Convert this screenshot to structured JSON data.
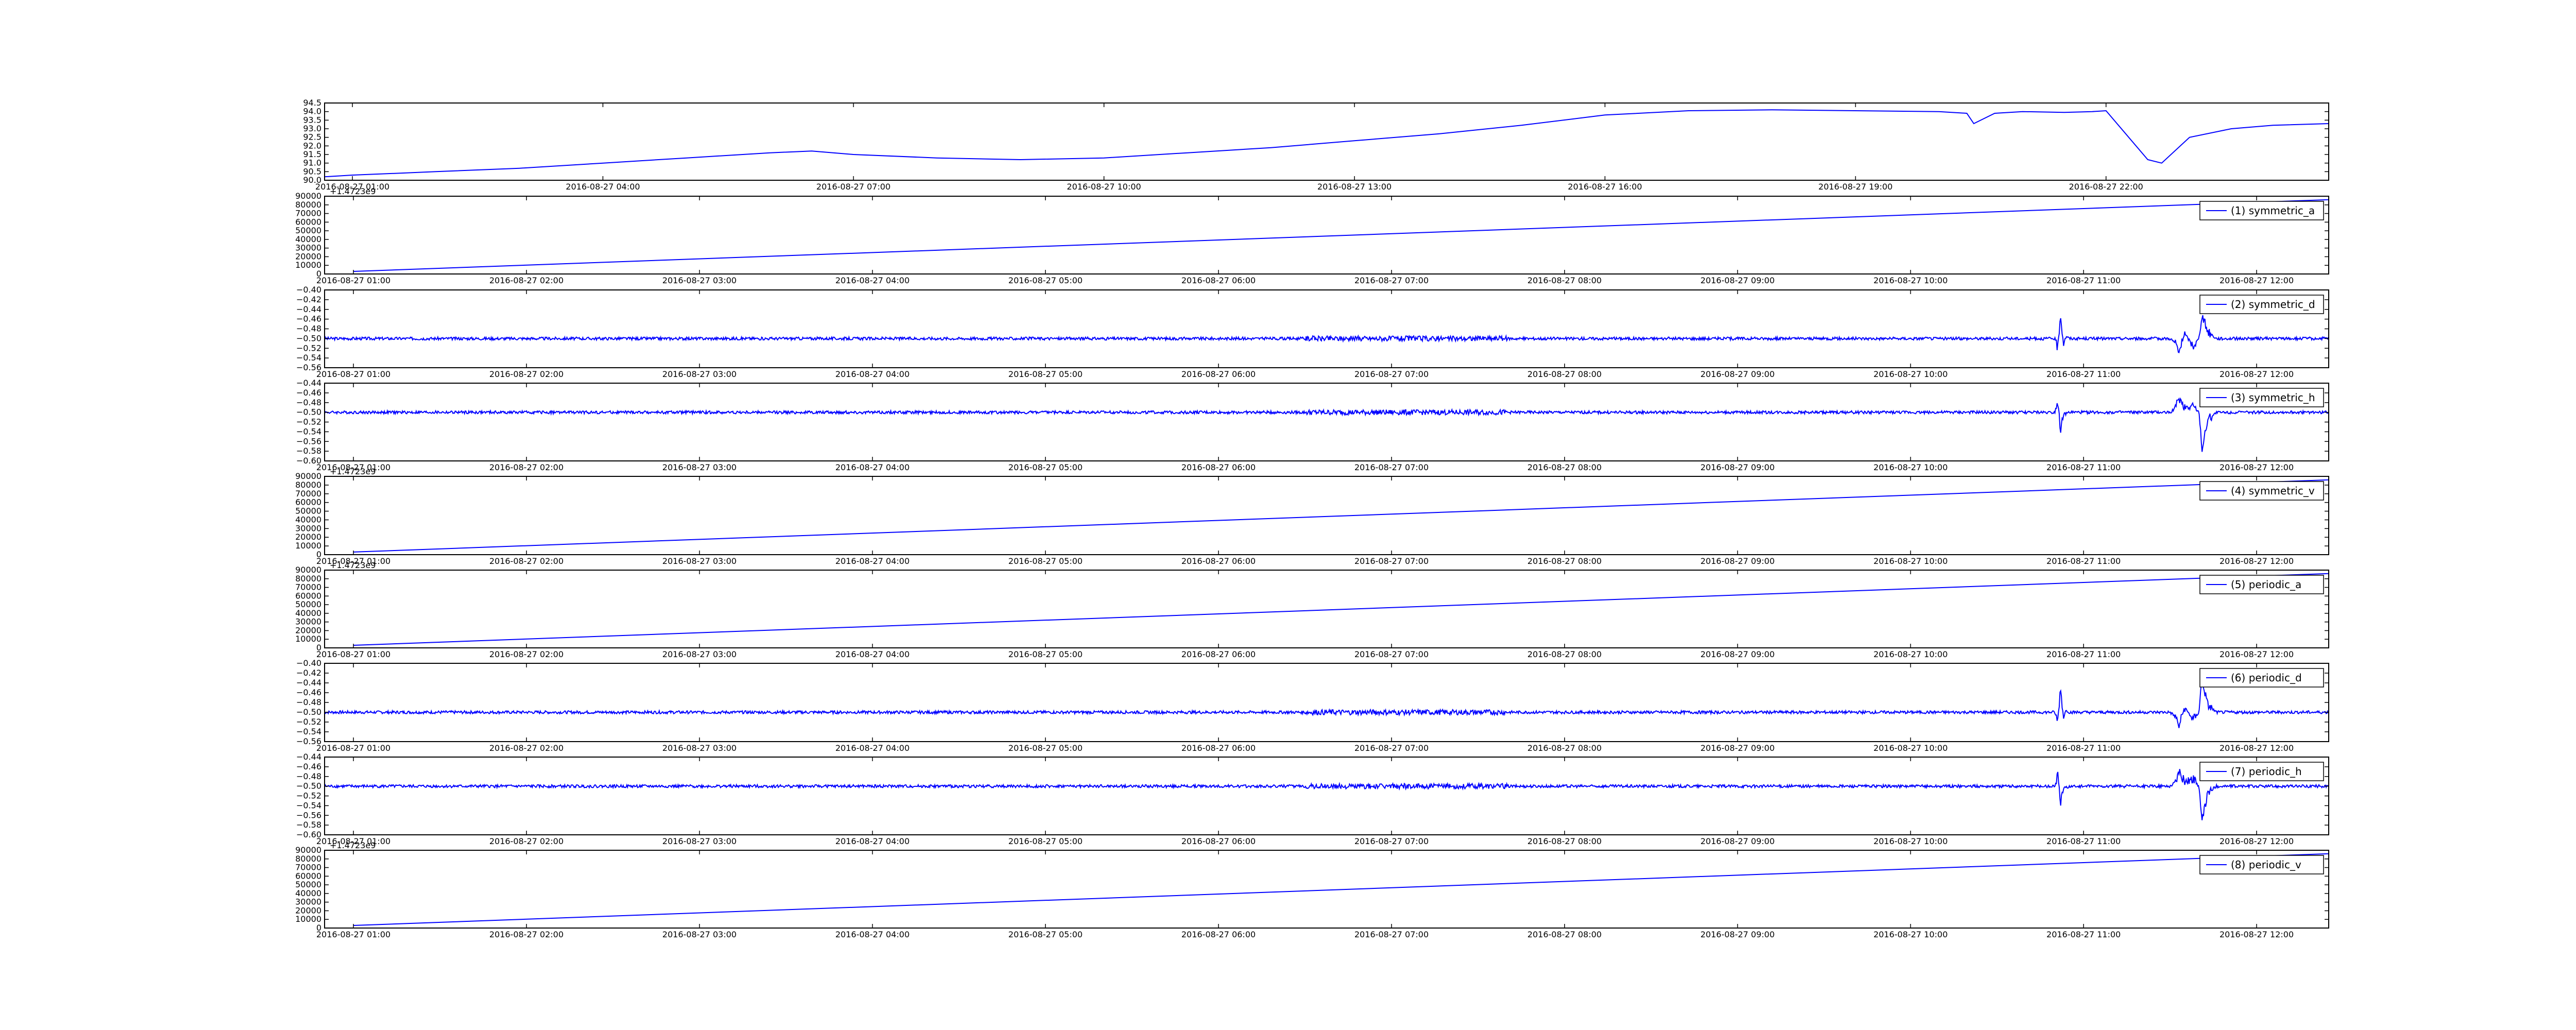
{
  "figure": {
    "line_color": "#0000ff",
    "axis_color": "#000000",
    "background": "#ffffff"
  },
  "chart_data": [
    {
      "type": "line",
      "title": "",
      "xlabel": "",
      "ylabel": "",
      "offset_label": "",
      "legend": null,
      "ylim": [
        90.0,
        94.5
      ],
      "y_ticks": [
        "90.0",
        "90.5",
        "91.0",
        "91.5",
        "92.0",
        "92.5",
        "93.0",
        "93.5",
        "94.0",
        "94.5"
      ],
      "x_ticks": [
        "2016-08-27 01:00",
        "2016-08-27 04:00",
        "2016-08-27 07:00",
        "2016-08-27 10:00",
        "2016-08-27 13:00",
        "2016-08-27 16:00",
        "2016-08-27 19:00",
        "2016-08-27 22:00"
      ],
      "x_tick_labels": [
        "2016-08-27 01:00",
        "2016-08-27 04:00",
        "2016-08-27 07:00",
        "2016-08-27 10:00",
        "2016-08-27 13:00",
        "2016-08-27 16:00",
        "2016-08-27 19:00",
        "2016-08-27 22:00"
      ],
      "xlim": [
        "2016-08-27 00:40",
        "2016-08-28 00:40"
      ],
      "series": [
        {
          "x": [
            "2016-08-27 00:40",
            "2016-08-27 01:00",
            "2016-08-27 01:30",
            "2016-08-27 02:00",
            "2016-08-27 03:00",
            "2016-08-27 04:00",
            "2016-08-27 05:00",
            "2016-08-27 06:00",
            "2016-08-27 06:30",
            "2016-08-27 07:00",
            "2016-08-27 08:00",
            "2016-08-27 09:00",
            "2016-08-27 10:00",
            "2016-08-27 11:00",
            "2016-08-27 12:00",
            "2016-08-27 13:00",
            "2016-08-27 14:00",
            "2016-08-27 15:00",
            "2016-08-27 16:00",
            "2016-08-27 17:00",
            "2016-08-27 18:00",
            "2016-08-27 19:00",
            "2016-08-27 20:00",
            "2016-08-27 20:20",
            "2016-08-27 20:25",
            "2016-08-27 20:40",
            "2016-08-27 21:00",
            "2016-08-27 21:30",
            "2016-08-27 21:50",
            "2016-08-27 22:00",
            "2016-08-27 22:30",
            "2016-08-27 22:40",
            "2016-08-27 23:00",
            "2016-08-27 23:30",
            "2016-08-28 00:00",
            "2016-08-28 00:40"
          ],
          "y": [
            90.2,
            90.3,
            90.4,
            90.5,
            90.7,
            91.0,
            91.3,
            91.6,
            91.7,
            91.5,
            91.3,
            91.2,
            91.3,
            91.6,
            91.9,
            92.3,
            92.7,
            93.2,
            93.8,
            94.05,
            94.1,
            94.05,
            94.0,
            93.9,
            93.3,
            93.9,
            94.0,
            93.95,
            94.0,
            94.05,
            91.2,
            91.0,
            92.5,
            93.0,
            93.2,
            93.3
          ]
        }
      ]
    },
    {
      "type": "line",
      "title": "",
      "xlabel": "",
      "ylabel": "",
      "offset_label": "+1.4723e9",
      "legend": "(1) symmetric_a",
      "ylim": [
        0,
        90000
      ],
      "y_ticks": [
        "0",
        "10000",
        "20000",
        "30000",
        "40000",
        "50000",
        "60000",
        "70000",
        "80000",
        "90000"
      ],
      "x_ticks": [
        "2016-08-27 01:00",
        "2016-08-27 02:00",
        "2016-08-27 03:00",
        "2016-08-27 04:00",
        "2016-08-27 05:00",
        "2016-08-27 06:00",
        "2016-08-27 07:00",
        "2016-08-27 08:00",
        "2016-08-27 09:00",
        "2016-08-27 10:00",
        "2016-08-27 11:00",
        "2016-08-27 12:00"
      ],
      "x_tick_labels": [
        "2016-08-27 01:00",
        "2016-08-27 02:00",
        "2016-08-27 03:00",
        "2016-08-27 04:00",
        "2016-08-27 05:00",
        "2016-08-27 06:00",
        "2016-08-27 07:00",
        "2016-08-27 08:00",
        "2016-08-27 09:00",
        "2016-08-27 10:00",
        "2016-08-27 11:00",
        "2016-08-27 12:00"
      ],
      "xlim": [
        "2016-08-27 00:50",
        "2016-08-27 12:25"
      ],
      "series": [
        {
          "name": "(1) symmetric_a",
          "x": [
            "2016-08-27 01:00",
            "2016-08-27 12:25"
          ],
          "y": [
            3000,
            86000
          ]
        }
      ]
    },
    {
      "type": "line",
      "title": "",
      "xlabel": "",
      "ylabel": "",
      "offset_label": "",
      "legend": "(2) symmetric_d",
      "ylim": [
        -0.56,
        -0.4
      ],
      "y_ticks": [
        "-0.56",
        "-0.54",
        "-0.52",
        "-0.50",
        "-0.48",
        "-0.46",
        "-0.44",
        "-0.42",
        "-0.40"
      ],
      "x_ticks": [
        "2016-08-27 01:00",
        "2016-08-27 02:00",
        "2016-08-27 03:00",
        "2016-08-27 04:00",
        "2016-08-27 05:00",
        "2016-08-27 06:00",
        "2016-08-27 07:00",
        "2016-08-27 08:00",
        "2016-08-27 09:00",
        "2016-08-27 10:00",
        "2016-08-27 11:00",
        "2016-08-27 12:00"
      ],
      "x_tick_labels": [
        "2016-08-27 01:00",
        "2016-08-27 02:00",
        "2016-08-27 03:00",
        "2016-08-27 04:00",
        "2016-08-27 05:00",
        "2016-08-27 06:00",
        "2016-08-27 07:00",
        "2016-08-27 08:00",
        "2016-08-27 09:00",
        "2016-08-27 10:00",
        "2016-08-27 11:00",
        "2016-08-27 12:00"
      ],
      "xlim": [
        "2016-08-27 00:50",
        "2016-08-27 12:25"
      ],
      "series": [
        {
          "name": "(2) symmetric_d",
          "baseline": -0.5,
          "noise": 0.003,
          "x": [
            "2016-08-27 00:50",
            "2016-08-27 10:50",
            "2016-08-27 10:51",
            "2016-08-27 10:52",
            "2016-08-27 10:53",
            "2016-08-27 10:54",
            "2016-08-27 10:55",
            "2016-08-27 11:30",
            "2016-08-27 11:32",
            "2016-08-27 11:33",
            "2016-08-27 11:35",
            "2016-08-27 11:38",
            "2016-08-27 11:40",
            "2016-08-27 11:41",
            "2016-08-27 11:43",
            "2016-08-27 11:46",
            "2016-08-27 12:25"
          ],
          "y": [
            -0.5,
            -0.5,
            -0.52,
            -0.45,
            -0.51,
            -0.495,
            -0.5,
            -0.5,
            -0.51,
            -0.53,
            -0.49,
            -0.515,
            -0.5,
            -0.45,
            -0.485,
            -0.5,
            -0.5
          ]
        }
      ]
    },
    {
      "type": "line",
      "title": "",
      "xlabel": "",
      "ylabel": "",
      "offset_label": "",
      "legend": "(3) symmetric_h",
      "ylim": [
        -0.6,
        -0.44
      ],
      "y_ticks": [
        "-0.60",
        "-0.58",
        "-0.56",
        "-0.54",
        "-0.52",
        "-0.50",
        "-0.48",
        "-0.46",
        "-0.44"
      ],
      "x_ticks": [
        "2016-08-27 01:00",
        "2016-08-27 02:00",
        "2016-08-27 03:00",
        "2016-08-27 04:00",
        "2016-08-27 05:00",
        "2016-08-27 06:00",
        "2016-08-27 07:00",
        "2016-08-27 08:00",
        "2016-08-27 09:00",
        "2016-08-27 10:00",
        "2016-08-27 11:00",
        "2016-08-27 12:00"
      ],
      "x_tick_labels": [
        "2016-08-27 01:00",
        "2016-08-27 02:00",
        "2016-08-27 03:00",
        "2016-08-27 04:00",
        "2016-08-27 05:00",
        "2016-08-27 06:00",
        "2016-08-27 07:00",
        "2016-08-27 08:00",
        "2016-08-27 09:00",
        "2016-08-27 10:00",
        "2016-08-27 11:00",
        "2016-08-27 12:00"
      ],
      "xlim": [
        "2016-08-27 00:50",
        "2016-08-27 12:25"
      ],
      "series": [
        {
          "name": "(3) symmetric_h",
          "baseline": -0.5,
          "noise": 0.003,
          "x": [
            "2016-08-27 00:50",
            "2016-08-27 10:50",
            "2016-08-27 10:51",
            "2016-08-27 10:52",
            "2016-08-27 10:53",
            "2016-08-27 10:55",
            "2016-08-27 11:30",
            "2016-08-27 11:32",
            "2016-08-27 11:33",
            "2016-08-27 11:35",
            "2016-08-27 11:38",
            "2016-08-27 11:40",
            "2016-08-27 11:41",
            "2016-08-27 11:43",
            "2016-08-27 11:46",
            "2016-08-27 12:25"
          ],
          "y": [
            -0.5,
            -0.5,
            -0.475,
            -0.535,
            -0.505,
            -0.5,
            -0.5,
            -0.49,
            -0.47,
            -0.49,
            -0.485,
            -0.5,
            -0.575,
            -0.515,
            -0.5,
            -0.5
          ]
        }
      ]
    },
    {
      "type": "line",
      "title": "",
      "xlabel": "",
      "ylabel": "",
      "offset_label": "+1.4723e9",
      "legend": "(4) symmetric_v",
      "ylim": [
        0,
        90000
      ],
      "y_ticks": [
        "0",
        "10000",
        "20000",
        "30000",
        "40000",
        "50000",
        "60000",
        "70000",
        "80000",
        "90000"
      ],
      "x_ticks": [
        "2016-08-27 01:00",
        "2016-08-27 02:00",
        "2016-08-27 03:00",
        "2016-08-27 04:00",
        "2016-08-27 05:00",
        "2016-08-27 06:00",
        "2016-08-27 07:00",
        "2016-08-27 08:00",
        "2016-08-27 09:00",
        "2016-08-27 10:00",
        "2016-08-27 11:00",
        "2016-08-27 12:00"
      ],
      "x_tick_labels": [
        "2016-08-27 01:00",
        "2016-08-27 02:00",
        "2016-08-27 03:00",
        "2016-08-27 04:00",
        "2016-08-27 05:00",
        "2016-08-27 06:00",
        "2016-08-27 07:00",
        "2016-08-27 08:00",
        "2016-08-27 09:00",
        "2016-08-27 10:00",
        "2016-08-27 11:00",
        "2016-08-27 12:00"
      ],
      "xlim": [
        "2016-08-27 00:50",
        "2016-08-27 12:25"
      ],
      "series": [
        {
          "name": "(4) symmetric_v",
          "x": [
            "2016-08-27 01:00",
            "2016-08-27 12:25"
          ],
          "y": [
            3000,
            86000
          ]
        }
      ]
    },
    {
      "type": "line",
      "title": "",
      "xlabel": "",
      "ylabel": "",
      "offset_label": "+1.4723e9",
      "legend": "(5) periodic_a",
      "ylim": [
        0,
        90000
      ],
      "y_ticks": [
        "0",
        "10000",
        "20000",
        "30000",
        "40000",
        "50000",
        "60000",
        "70000",
        "80000",
        "90000"
      ],
      "x_ticks": [
        "2016-08-27 01:00",
        "2016-08-27 02:00",
        "2016-08-27 03:00",
        "2016-08-27 04:00",
        "2016-08-27 05:00",
        "2016-08-27 06:00",
        "2016-08-27 07:00",
        "2016-08-27 08:00",
        "2016-08-27 09:00",
        "2016-08-27 10:00",
        "2016-08-27 11:00",
        "2016-08-27 12:00"
      ],
      "x_tick_labels": [
        "2016-08-27 01:00",
        "2016-08-27 02:00",
        "2016-08-27 03:00",
        "2016-08-27 04:00",
        "2016-08-27 05:00",
        "2016-08-27 06:00",
        "2016-08-27 07:00",
        "2016-08-27 08:00",
        "2016-08-27 09:00",
        "2016-08-27 10:00",
        "2016-08-27 11:00",
        "2016-08-27 12:00"
      ],
      "xlim": [
        "2016-08-27 00:50",
        "2016-08-27 12:25"
      ],
      "series": [
        {
          "name": "(5) periodic_a",
          "x": [
            "2016-08-27 01:00",
            "2016-08-27 12:25"
          ],
          "y": [
            3000,
            86000
          ]
        }
      ]
    },
    {
      "type": "line",
      "title": "",
      "xlabel": "",
      "ylabel": "",
      "offset_label": "",
      "legend": "(6) periodic_d",
      "ylim": [
        -0.56,
        -0.4
      ],
      "y_ticks": [
        "-0.56",
        "-0.54",
        "-0.52",
        "-0.50",
        "-0.48",
        "-0.46",
        "-0.44",
        "-0.42",
        "-0.40"
      ],
      "x_ticks": [
        "2016-08-27 01:00",
        "2016-08-27 02:00",
        "2016-08-27 03:00",
        "2016-08-27 04:00",
        "2016-08-27 05:00",
        "2016-08-27 06:00",
        "2016-08-27 07:00",
        "2016-08-27 08:00",
        "2016-08-27 09:00",
        "2016-08-27 10:00",
        "2016-08-27 11:00",
        "2016-08-27 12:00"
      ],
      "x_tick_labels": [
        "2016-08-27 01:00",
        "2016-08-27 02:00",
        "2016-08-27 03:00",
        "2016-08-27 04:00",
        "2016-08-27 05:00",
        "2016-08-27 06:00",
        "2016-08-27 07:00",
        "2016-08-27 08:00",
        "2016-08-27 09:00",
        "2016-08-27 10:00",
        "2016-08-27 11:00",
        "2016-08-27 12:00"
      ],
      "xlim": [
        "2016-08-27 00:50",
        "2016-08-27 12:25"
      ],
      "series": [
        {
          "name": "(6) periodic_d",
          "baseline": -0.5,
          "noise": 0.003,
          "x": [
            "2016-08-27 00:50",
            "2016-08-27 10:50",
            "2016-08-27 10:51",
            "2016-08-27 10:52",
            "2016-08-27 10:53",
            "2016-08-27 10:54",
            "2016-08-27 10:55",
            "2016-08-27 11:30",
            "2016-08-27 11:32",
            "2016-08-27 11:33",
            "2016-08-27 11:35",
            "2016-08-27 11:38",
            "2016-08-27 11:40",
            "2016-08-27 11:41",
            "2016-08-27 11:43",
            "2016-08-27 11:46",
            "2016-08-27 12:25"
          ],
          "y": [
            -0.5,
            -0.5,
            -0.52,
            -0.45,
            -0.51,
            -0.495,
            -0.5,
            -0.5,
            -0.51,
            -0.53,
            -0.49,
            -0.515,
            -0.5,
            -0.43,
            -0.485,
            -0.5,
            -0.5
          ]
        }
      ]
    },
    {
      "type": "line",
      "title": "",
      "xlabel": "",
      "ylabel": "",
      "offset_label": "",
      "legend": "(7) periodic_h",
      "ylim": [
        -0.6,
        -0.44
      ],
      "y_ticks": [
        "-0.60",
        "-0.58",
        "-0.56",
        "-0.54",
        "-0.52",
        "-0.50",
        "-0.48",
        "-0.46",
        "-0.44"
      ],
      "x_ticks": [
        "2016-08-27 01:00",
        "2016-08-27 02:00",
        "2016-08-27 03:00",
        "2016-08-27 04:00",
        "2016-08-27 05:00",
        "2016-08-27 06:00",
        "2016-08-27 07:00",
        "2016-08-27 08:00",
        "2016-08-27 09:00",
        "2016-08-27 10:00",
        "2016-08-27 11:00",
        "2016-08-27 12:00"
      ],
      "x_tick_labels": [
        "2016-08-27 01:00",
        "2016-08-27 02:00",
        "2016-08-27 03:00",
        "2016-08-27 04:00",
        "2016-08-27 05:00",
        "2016-08-27 06:00",
        "2016-08-27 07:00",
        "2016-08-27 08:00",
        "2016-08-27 09:00",
        "2016-08-27 10:00",
        "2016-08-27 11:00",
        "2016-08-27 12:00"
      ],
      "xlim": [
        "2016-08-27 00:50",
        "2016-08-27 12:25"
      ],
      "series": [
        {
          "name": "(7) periodic_h",
          "baseline": -0.5,
          "noise": 0.003,
          "x": [
            "2016-08-27 00:50",
            "2016-08-27 10:50",
            "2016-08-27 10:51",
            "2016-08-27 10:52",
            "2016-08-27 10:53",
            "2016-08-27 10:55",
            "2016-08-27 11:30",
            "2016-08-27 11:32",
            "2016-08-27 11:33",
            "2016-08-27 11:35",
            "2016-08-27 11:38",
            "2016-08-27 11:40",
            "2016-08-27 11:41",
            "2016-08-27 11:43",
            "2016-08-27 11:46",
            "2016-08-27 12:25"
          ],
          "y": [
            -0.5,
            -0.5,
            -0.475,
            -0.535,
            -0.505,
            -0.5,
            -0.5,
            -0.49,
            -0.47,
            -0.49,
            -0.485,
            -0.5,
            -0.575,
            -0.515,
            -0.5,
            -0.5
          ]
        }
      ]
    },
    {
      "type": "line",
      "title": "",
      "xlabel": "",
      "ylabel": "",
      "offset_label": "+1.4723e9",
      "legend": "(8) periodic_v",
      "ylim": [
        0,
        90000
      ],
      "y_ticks": [
        "0",
        "10000",
        "20000",
        "30000",
        "40000",
        "50000",
        "60000",
        "70000",
        "80000",
        "90000"
      ],
      "x_ticks": [
        "2016-08-27 01:00",
        "2016-08-27 02:00",
        "2016-08-27 03:00",
        "2016-08-27 04:00",
        "2016-08-27 05:00",
        "2016-08-27 06:00",
        "2016-08-27 07:00",
        "2016-08-27 08:00",
        "2016-08-27 09:00",
        "2016-08-27 10:00",
        "2016-08-27 11:00",
        "2016-08-27 12:00"
      ],
      "x_tick_labels": [
        "2016-08-27 01:00",
        "2016-08-27 02:00",
        "2016-08-27 03:00",
        "2016-08-27 04:00",
        "2016-08-27 05:00",
        "2016-08-27 06:00",
        "2016-08-27 07:00",
        "2016-08-27 08:00",
        "2016-08-27 09:00",
        "2016-08-27 10:00",
        "2016-08-27 11:00",
        "2016-08-27 12:00"
      ],
      "xlim": [
        "2016-08-27 00:50",
        "2016-08-27 12:25"
      ],
      "series": [
        {
          "name": "(8) periodic_v",
          "x": [
            "2016-08-27 01:00",
            "2016-08-27 12:25"
          ],
          "y": [
            3000,
            86000
          ]
        }
      ]
    }
  ]
}
